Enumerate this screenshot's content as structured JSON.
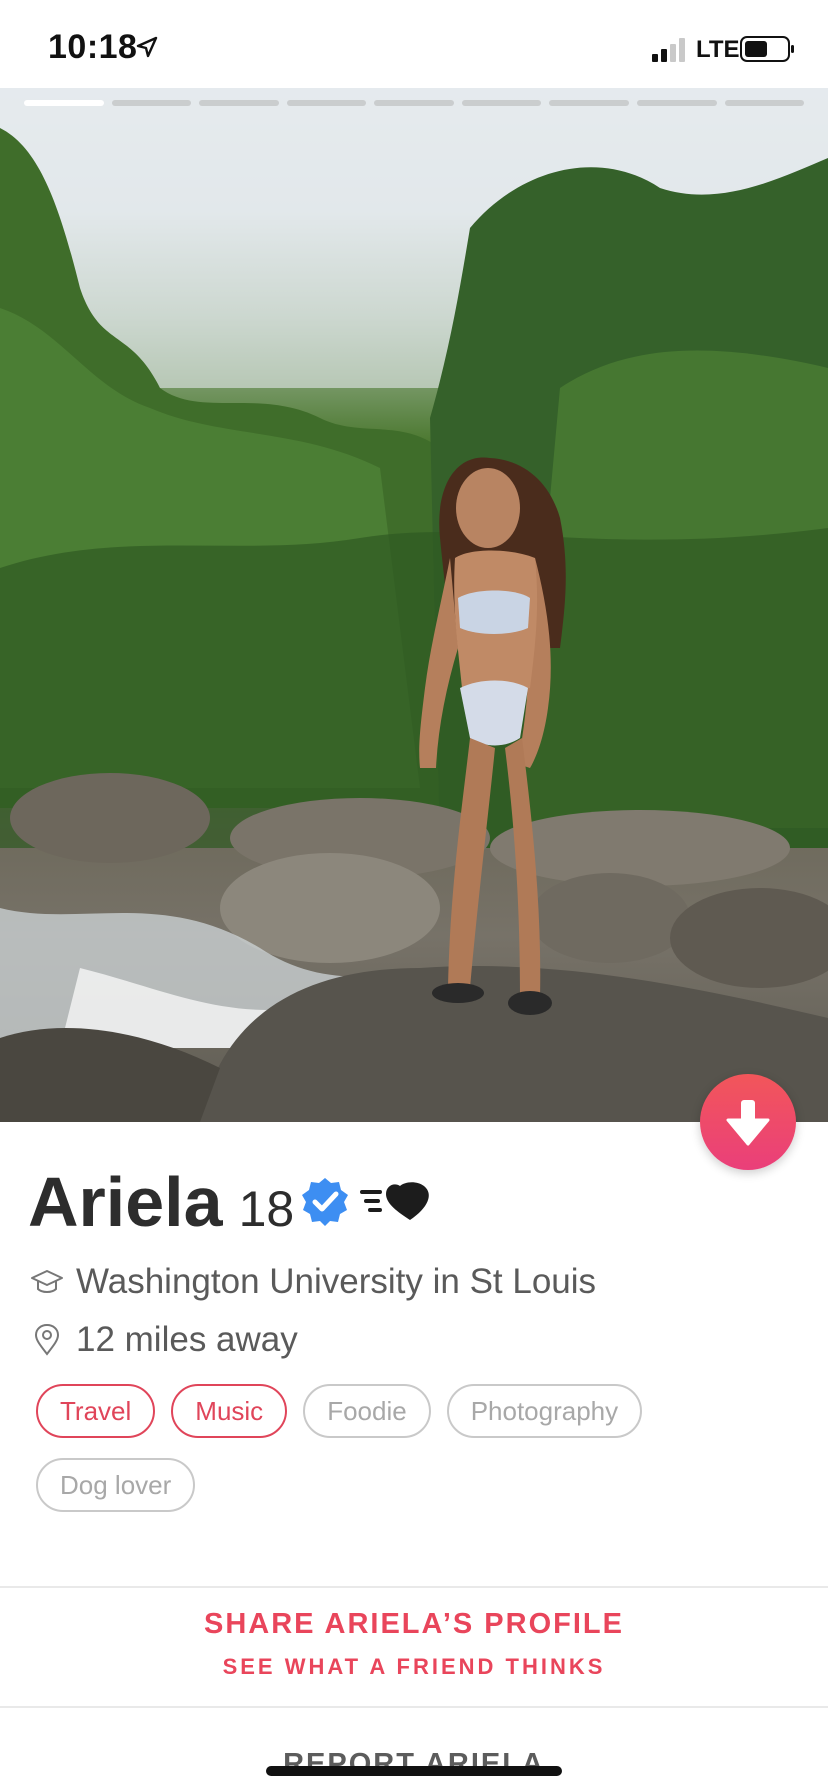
{
  "status_bar": {
    "time": "10:18",
    "network": "LTE"
  },
  "photo": {
    "photo_count": 9,
    "active_index": 0
  },
  "profile": {
    "name": "Ariela",
    "age": "18",
    "school": "Washington University in St Louis",
    "distance": "12 miles away"
  },
  "interests": [
    {
      "label": "Travel",
      "shared": true
    },
    {
      "label": "Music",
      "shared": true
    },
    {
      "label": "Foodie",
      "shared": false
    },
    {
      "label": "Photography",
      "shared": false
    },
    {
      "label": "Dog lover",
      "shared": false
    }
  ],
  "actions": {
    "share_title": "SHARE ARIELA’S PROFILE",
    "share_subtitle": "SEE WHAT A FRIEND THINKS",
    "report": "REPORT ARIELA"
  },
  "colors": {
    "accent": "#e9455b",
    "fab_top": "#f2565a",
    "fab_bottom": "#ea3f7a",
    "verified": "#3d8ef2"
  }
}
